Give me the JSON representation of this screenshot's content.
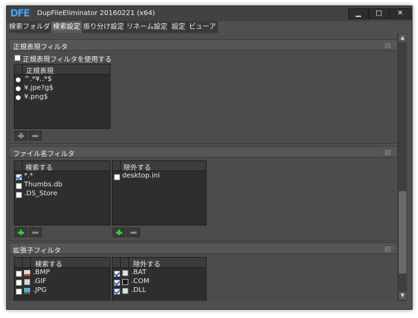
{
  "window": {
    "title": "DupFileEliminator 20160221 (x64)",
    "logo": "DFE",
    "min_glyph": "▁",
    "max_glyph": "□",
    "close_glyph": "✕"
  },
  "tabs": [
    {
      "label": "検索フォルダ"
    },
    {
      "label": "検索設定"
    },
    {
      "label": "振り分け設定"
    },
    {
      "label": "リネーム設定"
    },
    {
      "label": "設定"
    },
    {
      "label": "ビューア"
    }
  ],
  "regex_filter": {
    "title": "正規表現フィルタ",
    "use_label": "正規表現フィルタを使用する",
    "column_header": "正規表現",
    "items": [
      "^.*¥..*$",
      "¥.jpe?g$",
      "¥.png$"
    ]
  },
  "filename_filter": {
    "title": "ファイル名フィルタ",
    "include_header": "検索する",
    "exclude_header": "除外する",
    "include_items": [
      {
        "label": "*.*",
        "checked": true
      },
      {
        "label": "Thumbs.db",
        "checked": false
      },
      {
        "label": ".DS_Store",
        "checked": false
      }
    ],
    "exclude_items": [
      {
        "label": "desktop.ini",
        "checked": false
      }
    ]
  },
  "extension_filter": {
    "title": "拡張子フィルタ",
    "include_header": "検索する",
    "exclude_header": "除外する",
    "include_items": [
      {
        "label": ".BMP",
        "checked": false,
        "icon": "bmp-file-icon"
      },
      {
        "label": ".GIF",
        "checked": false,
        "icon": "gif-file-icon"
      },
      {
        "label": ".JPG",
        "checked": false,
        "icon": "jpg-file-icon"
      }
    ],
    "exclude_items": [
      {
        "label": ".BAT",
        "checked": true,
        "icon": "bat-file-icon"
      },
      {
        "label": ".COM",
        "checked": true,
        "icon": "com-file-icon"
      },
      {
        "label": ".DLL",
        "checked": true,
        "icon": "dll-file-icon"
      }
    ]
  },
  "scrollbar": {
    "up_glyph": "▲",
    "down_glyph": "▼"
  },
  "colors": {
    "add_enabled": "#33cc33",
    "add_disabled": "#8a8a8a"
  }
}
